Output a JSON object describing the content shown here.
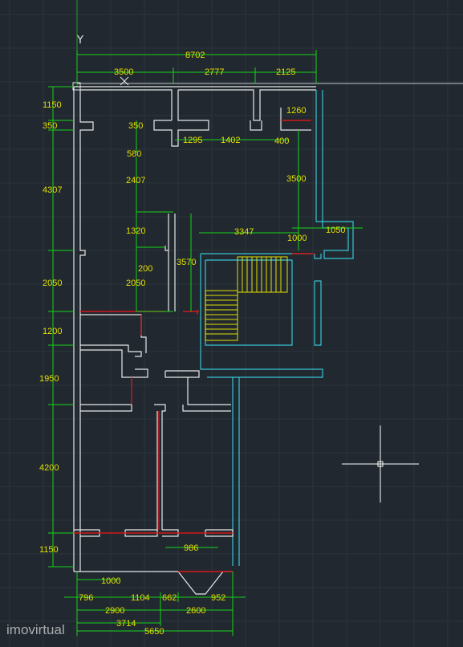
{
  "ucs_label": "Y",
  "watermark": "imovirtual",
  "colors": {
    "background": "#212830",
    "grid": "#2b333d",
    "wall": "#e8e8e8",
    "dimension_line": "#17d417",
    "dimension_text": "#e3e000",
    "stair_outline": "#36c6d6",
    "door_red": "#d01818",
    "crosshair": "#ffffff"
  },
  "dimensions": {
    "top_overall": "8702",
    "top_seg_1": "3500",
    "top_seg_2": "2777",
    "top_seg_3": "2125",
    "right_1260": "1260",
    "left_1150": "1150",
    "left_350": "350",
    "left_4307": "4307",
    "left_2050": "2050",
    "left_1200": "1200",
    "left_1950": "1950",
    "left_4200": "4200",
    "left_1150_bottom": "1150",
    "inner_350": "350",
    "inner_580": "580",
    "inner_1295": "1295",
    "inner_1402": "1402",
    "inner_400": "400",
    "inner_2407": "2407",
    "inner_3500": "3500",
    "inner_1320": "1320",
    "inner_3347": "3347",
    "inner_1000": "1000",
    "inner_1050": "1050",
    "inner_200": "200",
    "inner_3570": "3570",
    "inner_2050": "2050",
    "inner_986": "986",
    "bottom_1000": "1000",
    "bottom_796": "796",
    "bottom_1104": "1104",
    "bottom_662": "662",
    "bottom_952": "952",
    "bottom_2900": "2900",
    "bottom_2600": "2600",
    "bottom_3714": "3714",
    "bottom_5650": "5650"
  }
}
